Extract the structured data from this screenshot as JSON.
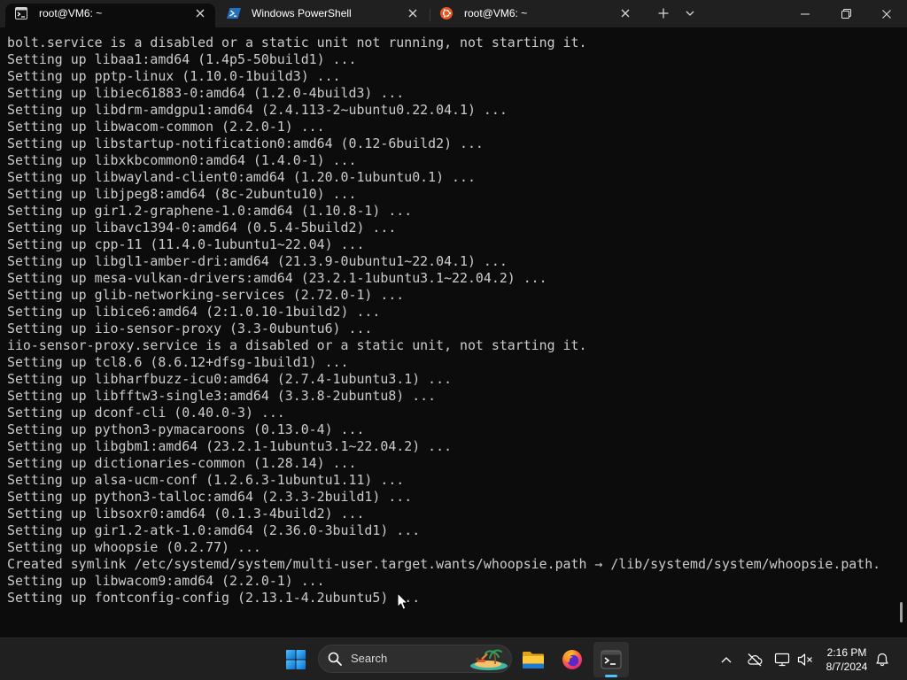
{
  "window": {
    "tabs": [
      {
        "title": "root@VM6: ~",
        "icon": "cmd-icon",
        "active": true
      },
      {
        "title": "Windows PowerShell",
        "icon": "powershell-icon",
        "active": false
      },
      {
        "title": "root@VM6: ~",
        "icon": "ubuntu-icon",
        "active": false
      }
    ],
    "tab_actions": {
      "new_tab_icon": "plus-icon",
      "dropdown_icon": "chevron-down-icon"
    },
    "controls": {
      "minimize_icon": "minimize-icon",
      "restore_icon": "restore-icon",
      "close_icon": "close-icon"
    }
  },
  "terminal": {
    "scroll_fraction": 0.98,
    "lines": [
      "bolt.service is a disabled or a static unit not running, not starting it.",
      "Setting up libaa1:amd64 (1.4p5-50build1) ...",
      "Setting up pptp-linux (1.10.0-1build3) ...",
      "Setting up libiec61883-0:amd64 (1.2.0-4build3) ...",
      "Setting up libdrm-amdgpu1:amd64 (2.4.113-2~ubuntu0.22.04.1) ...",
      "Setting up libwacom-common (2.2.0-1) ...",
      "Setting up libstartup-notification0:amd64 (0.12-6build2) ...",
      "Setting up libxkbcommon0:amd64 (1.4.0-1) ...",
      "Setting up libwayland-client0:amd64 (1.20.0-1ubuntu0.1) ...",
      "Setting up libjpeg8:amd64 (8c-2ubuntu10) ...",
      "Setting up gir1.2-graphene-1.0:amd64 (1.10.8-1) ...",
      "Setting up libavc1394-0:amd64 (0.5.4-5build2) ...",
      "Setting up cpp-11 (11.4.0-1ubuntu1~22.04) ...",
      "Setting up libgl1-amber-dri:amd64 (21.3.9-0ubuntu1~22.04.1) ...",
      "Setting up mesa-vulkan-drivers:amd64 (23.2.1-1ubuntu3.1~22.04.2) ...",
      "Setting up glib-networking-services (2.72.0-1) ...",
      "Setting up libice6:amd64 (2:1.0.10-1build2) ...",
      "Setting up iio-sensor-proxy (3.3-0ubuntu6) ...",
      "iio-sensor-proxy.service is a disabled or a static unit, not starting it.",
      "Setting up tcl8.6 (8.6.12+dfsg-1build1) ...",
      "Setting up libharfbuzz-icu0:amd64 (2.7.4-1ubuntu3.1) ...",
      "Setting up libfftw3-single3:amd64 (3.3.8-2ubuntu8) ...",
      "Setting up dconf-cli (0.40.0-3) ...",
      "Setting up python3-pymacaroons (0.13.0-4) ...",
      "Setting up libgbm1:amd64 (23.2.1-1ubuntu3.1~22.04.2) ...",
      "Setting up dictionaries-common (1.28.14) ...",
      "Setting up alsa-ucm-conf (1.2.6.3-1ubuntu1.11) ...",
      "Setting up python3-talloc:amd64 (2.3.3-2build1) ...",
      "Setting up libsoxr0:amd64 (0.1.3-4build2) ...",
      "Setting up gir1.2-atk-1.0:amd64 (2.36.0-3build1) ...",
      "Setting up whoopsie (0.2.77) ...",
      "Created symlink /etc/systemd/system/multi-user.target.wants/whoopsie.path → /lib/systemd/system/whoopsie.path.",
      "Setting up libwacom9:amd64 (2.2.0-1) ...",
      "Setting up fontconfig-config (2.13.1-4.2ubuntu5) ..."
    ]
  },
  "taskbar": {
    "start_icon": "windows-start-icon",
    "search": {
      "placeholder": "Search",
      "icon": "search-icon"
    },
    "pinned_apps": [
      {
        "icon": "folder-icon",
        "active": false
      },
      {
        "icon": "firefox-icon",
        "active": false
      },
      {
        "icon": "terminal-icon",
        "active": true
      }
    ],
    "tray_icons": [
      "chevron-up-icon",
      "cloud-offline-icon",
      "network-icon",
      "volume-muted-icon"
    ],
    "clock": {
      "time": "2:16 PM",
      "date": "8/7/2024"
    },
    "notification_icon": "bell-icon"
  },
  "colors": {
    "tab_row": "#202020",
    "active_tab": "#0c0c0c",
    "terminal_background": "#0c0c0c",
    "terminal_foreground": "#cccccc",
    "taskbar_background": "#202020",
    "accent": "#4cc2ff"
  }
}
